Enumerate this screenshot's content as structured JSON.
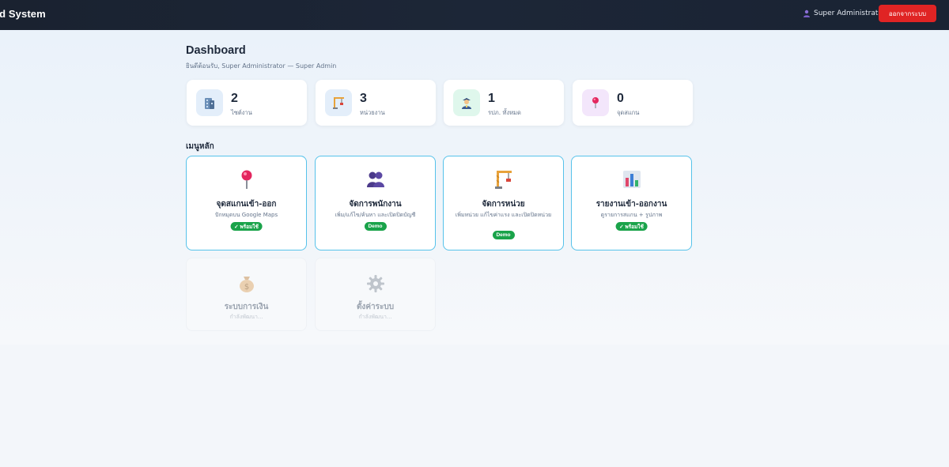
{
  "header": {
    "brand": "rd System",
    "user_name": "Super Administrator",
    "logout_label": "ออกจากระบบ"
  },
  "page": {
    "title": "Dashboard",
    "subtitle": "ยินดีต้อนรับ, Super Administrator — Super Admin"
  },
  "stats": [
    {
      "value": "2",
      "label": "ไซต์งาน",
      "icon": "building-icon",
      "bg": "#e3eefa"
    },
    {
      "value": "3",
      "label": "หน่วยงาน",
      "icon": "construction-crane-icon",
      "bg": "#e3eefa"
    },
    {
      "value": "1",
      "label": "รปภ. ทั้งหมด",
      "icon": "security-guard-icon",
      "bg": "#dff7ec"
    },
    {
      "value": "0",
      "label": "จุดสแกน",
      "icon": "map-pin-icon",
      "bg": "#f3e6fb"
    }
  ],
  "menu": {
    "section_title": "เมนูหลัก",
    "cards": [
      {
        "title": "จุดสแกนเข้า-ออก",
        "desc": "ปักหมุดบน Google Maps",
        "badge": "✓ พร้อมใช้",
        "icon": "map-pin-icon",
        "state": "ready"
      },
      {
        "title": "จัดการพนักงาน",
        "desc": "เพิ่ม/แก้ไข/ค้นหา และเปิดปิดบัญชี",
        "badge": "Demo",
        "icon": "people-icon",
        "state": "demo"
      },
      {
        "title": "จัดการหน่วย",
        "desc": "เพิ่มหน่วย แก้ไขค่าแรง และเปิดปิดหน่วย",
        "badge": "Demo",
        "icon": "construction-crane-icon",
        "state": "demo"
      },
      {
        "title": "รายงานเข้า-ออกงาน",
        "desc": "ดูรายการสแกน + รูปภาพ",
        "badge": "✓ พร้อมใช้",
        "icon": "bar-chart-icon",
        "state": "ready"
      },
      {
        "title": "ระบบการเงิน",
        "desc": "กำลังพัฒนา...",
        "badge": "",
        "icon": "money-bag-icon",
        "state": "disabled"
      },
      {
        "title": "ตั้งค่าระบบ",
        "desc": "กำลังพัฒนา...",
        "badge": "",
        "icon": "gear-icon",
        "state": "disabled"
      }
    ]
  },
  "colors": {
    "topbar": "#1a2230",
    "logout": "#e02424",
    "card_border": "#56c2ea",
    "badge": "#1aa34a"
  }
}
